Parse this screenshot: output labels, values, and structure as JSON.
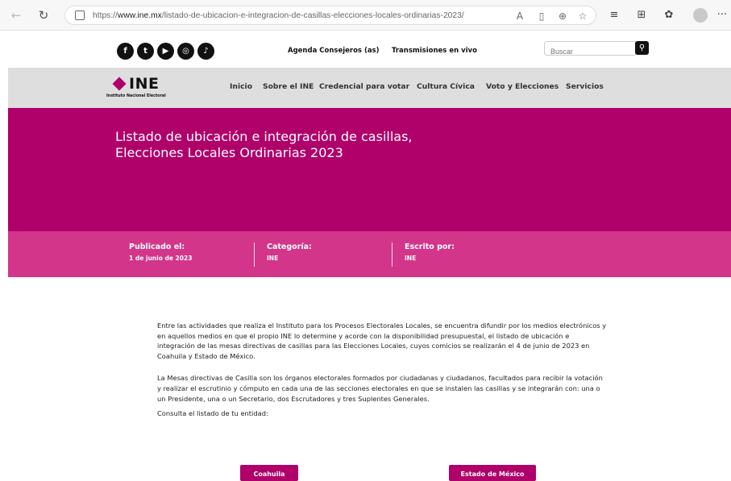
{
  "browser": {
    "url_prefix": "https://",
    "url_domain": "www.ine.mx",
    "url_path": "/listado-de-ubicacion-e-integracion-de-casillas-elecciones-locales-ordinarias-2023/",
    "icons": [
      "back-icon",
      "refresh-icon",
      "lock-icon",
      "read-aloud-icon",
      "immersive-reader-icon",
      "zoom-icon",
      "favorite-icon",
      "favorites-bar-icon",
      "collections-icon",
      "extension-icon",
      "profile-icon",
      "more-icon"
    ],
    "more": "···"
  },
  "site": {
    "social": [
      "f",
      "t",
      "▶",
      "◎",
      "♪"
    ],
    "top_links": {
      "agenda": "Agenda Consejeros (as)",
      "transmisiones": "Transmisiones en vivo"
    },
    "search": {
      "placeholder": "Buscar"
    },
    "logo": {
      "brand": "INE",
      "subtitle": "Instituto Nacional Electoral"
    },
    "nav": [
      "Inicio",
      "Sobre el INE",
      "Credencial para votar",
      "Cultura Cívica",
      "Voto y Elecciones",
      "Servicios"
    ],
    "colors": {
      "primary": "#b0006a",
      "secondary": "#d2358a",
      "nav_bg": "#dedede"
    }
  },
  "hero": {
    "title_line1": "Listado de ubicación e integración de casillas,",
    "title_line2": "Elecciones Locales Ordinarias 2023"
  },
  "meta": {
    "published_label": "Publicado el:",
    "published_value": "1 de junio de 2023",
    "category_label": "Categoría:",
    "category_value": "INE",
    "author_label": "Escrito por:",
    "author_value": "INE"
  },
  "article": {
    "p1": "Entre las actividades que realiza el Instituto para los Procesos Electorales Locales, se encuentra difundir por los medios electrónicos y en aquellos medios en que el propio INE lo determine y acorde con la disponibilidad presupuestal, el listado de ubicación e integración de las mesas directivas de casillas para las Elecciones Locales, cuyos comicios se realizarán el 4 de junio de 2023 en Coahuila y Estado de México.",
    "p2": "La Mesas directivas de Casilla son los órganos electorales formados por ciudadanas y ciudadanos, facultados para recibir la votación y realizar el escrutinio y cómputo en cada una de las secciones electorales en que se instalen las casillas y se integrarán con: una o un Presidente, una o un Secretario, dos Escrutadores y tres Suplentes Generales.",
    "p3": "Consulta el listado de tu entidad:"
  },
  "buttons": {
    "coahuila": "Coahuila",
    "edomex": "Estado de México"
  }
}
